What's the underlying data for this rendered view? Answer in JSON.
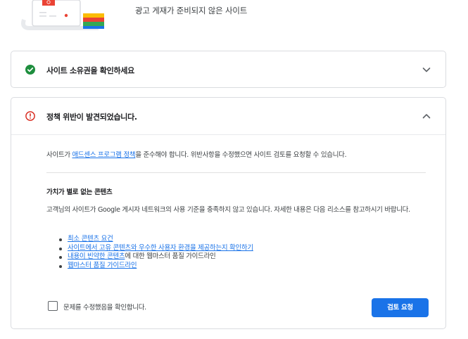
{
  "hero": {
    "text": "광고 게재가 준비되지 않은 사이트"
  },
  "card_ownership": {
    "title": "사이트 소유권을 확인하세요",
    "status_icon": "check-circle-icon",
    "status_color": "#1e8e3e",
    "expand_icon": "chevron-down-icon",
    "expanded": false
  },
  "card_policy": {
    "title": "정책 위반이 발견되었습니다.",
    "status_icon": "error-circle-icon",
    "status_color": "#d93025",
    "expand_icon": "chevron-up-icon",
    "expanded": true,
    "summary_prefix": "사이트가 ",
    "summary_link": "애드센스 프로그램 정책",
    "summary_suffix": "을 준수해야 합니다. 위반사항을 수정했으면 사이트 검토를 요청할 수 있습니다.",
    "section_title": "가치가 별로 없는 콘텐츠",
    "description": "고객님의 사이트가 Google 게시자 네트워크의 사용 기준을 충족하지 않고 있습니다. 자세한 내용은 다음 리소스를 참고하시기 바랍니다.",
    "resources": [
      {
        "link": "최소 콘텐츠 요건",
        "suffix": ""
      },
      {
        "link": "사이트에서 고유 콘텐츠와 우수한 사용자 환경을 제공하는지 확인하기",
        "suffix": ""
      },
      {
        "link": "내용이 빈약한 콘텐츠",
        "suffix": "에 대한 웹마스터 품질 가이드라인"
      },
      {
        "link": "웹마스터 품질 가이드라인",
        "suffix": ""
      }
    ],
    "checkbox_label": "문제를 수정했음을 확인합니다.",
    "checkbox_checked": false,
    "review_button": "검토 요청"
  },
  "colors": {
    "accent": "#1a73e8",
    "border": "#dadce0"
  }
}
